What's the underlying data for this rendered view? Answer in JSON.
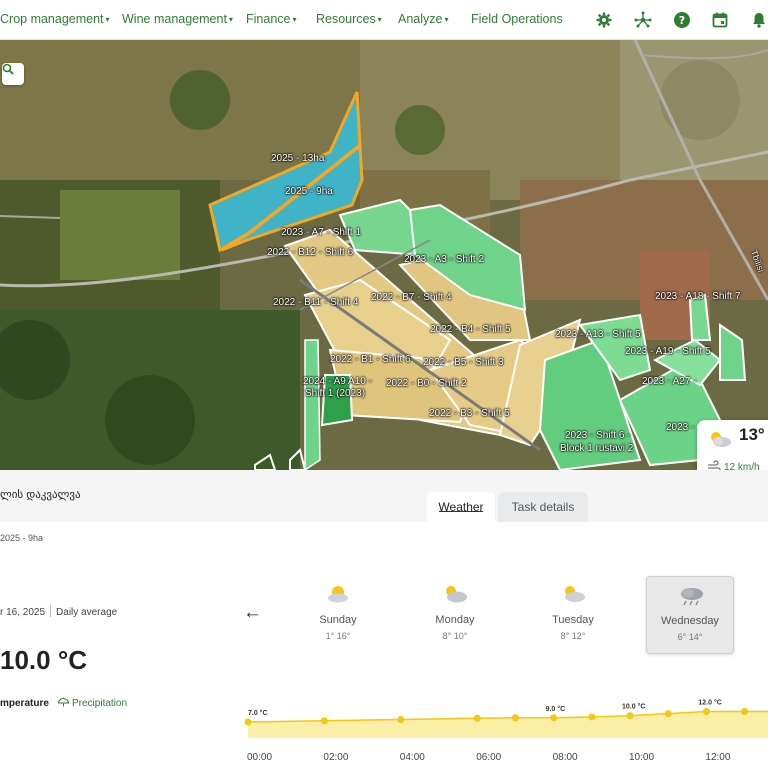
{
  "nav": {
    "items": [
      {
        "label": "Crop management",
        "dropdown": true
      },
      {
        "label": "Wine management",
        "dropdown": true
      },
      {
        "label": "Finance",
        "dropdown": true
      },
      {
        "label": "Resources",
        "dropdown": true
      },
      {
        "label": "Analyze",
        "dropdown": true
      },
      {
        "label": "Field Operations",
        "dropdown": false
      }
    ],
    "icons": [
      "gear-icon",
      "network-icon",
      "help-icon",
      "calendar-icon",
      "bell-icon"
    ],
    "accent_color": "#2e7d32"
  },
  "map": {
    "field_labels": [
      "2025 - 13ha",
      "2025 - 9ha",
      "2023 - A7 - Shift 1",
      "2022 - B12 - Shift 6",
      "2023 - A3 - Shift 2",
      "2022 - B11 - Shift 4",
      "2022 - B7 - Shift 4",
      "2022 - B4 - Shift 5",
      "2022 - B1 - Shift 6",
      "2022 - B5 - Shift 3",
      "2024 - A9 A10 -",
      "Shift 1 (2023)",
      "2022 - B0 - Shift 2",
      "2022 - B3 - Shift 5",
      "2023 - A18 - Shift 7",
      "2023 - A13 - Shift 5",
      "2023 - A19 - Shift 5",
      "2023 - A27 -",
      "2023 -",
      "2023 - Shift 6 -",
      "Block 1 rustavi 2",
      "Tbilisi"
    ],
    "weather_card": {
      "temp": "13°",
      "wind": "12 km/h"
    },
    "colors": {
      "selected_field": "#40b8c8",
      "selected_border": "#f5a623",
      "field_2022": "#e2c882",
      "field_2023": "#6fd389",
      "field_2024": "#2ea04a"
    }
  },
  "panel": {
    "title": "ლის დაკვალვა",
    "tabs": [
      {
        "label": "Weather",
        "active": true
      },
      {
        "label": "Task details",
        "active": false
      }
    ],
    "field_name": "2025 - 9ha",
    "date": "r 16, 2025",
    "date_mode": "Daily average",
    "current_temp": "10.0 °C",
    "metrics": [
      {
        "label": "mperature",
        "active": true
      },
      {
        "label": "Precipitation",
        "active": false
      }
    ],
    "days": [
      {
        "name": "Sunday",
        "range": "1° 16°",
        "icon": "sun-cloud-icon",
        "selected": false
      },
      {
        "name": "Monday",
        "range": "8° 10°",
        "icon": "sun-cloud-icon",
        "selected": false
      },
      {
        "name": "Tuesday",
        "range": "8° 12°",
        "icon": "sun-cloud-icon",
        "selected": false
      },
      {
        "name": "Wednesday",
        "range": "6° 14°",
        "icon": "rain-cloud-icon",
        "selected": true
      }
    ]
  },
  "chart_data": {
    "type": "area",
    "x": [
      "00:00",
      "01:00",
      "02:00",
      "03:00",
      "04:00",
      "05:00",
      "06:00",
      "07:00",
      "08:00",
      "09:00",
      "10:00",
      "11:00",
      "12:00",
      "13:00"
    ],
    "values": [
      7.0,
      7.3,
      7.6,
      7.9,
      8.2,
      8.5,
      8.8,
      9.0,
      9.0,
      9.4,
      10.0,
      11.0,
      12.0,
      12.0
    ],
    "point_labels": [
      {
        "x": "00:00",
        "label": "7.0 °C"
      },
      {
        "x": "08:00",
        "label": "9.0 °C"
      },
      {
        "x": "10:00",
        "label": "10.0 °C"
      },
      {
        "x": "12:00",
        "label": "12.0 °C"
      }
    ],
    "tick_labels": [
      "00:00",
      "02:00",
      "04:00",
      "06:00",
      "08:00",
      "10:00",
      "12:00"
    ],
    "ylim": [
      0,
      14
    ],
    "line_color": "#f2c811",
    "fill_color": "#fbeea6"
  }
}
